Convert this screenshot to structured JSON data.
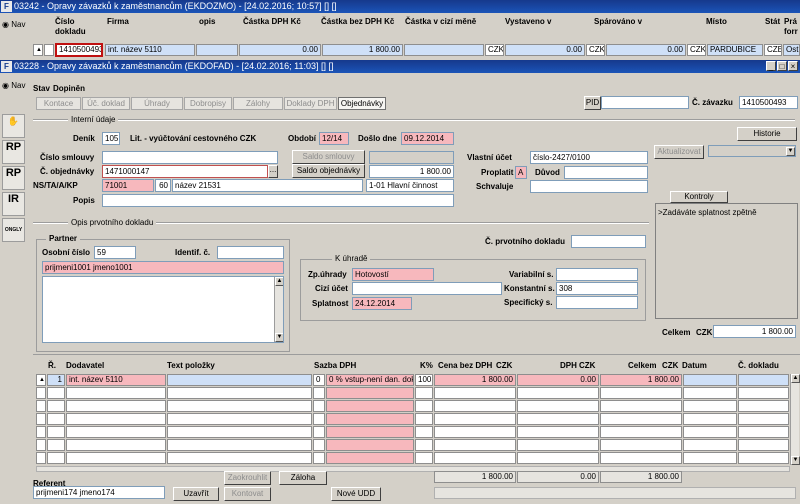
{
  "back_window": {
    "title": "03242 - Opravy závazků k zaměstnancům (EKDOZMO) - [24.02.2016; 10:57] [] []",
    "nav_label": "Nav",
    "columns": [
      "Číslo dokladu",
      "Firma",
      "opis",
      "Částka DPH Kč",
      "Částka bez DPH Kč",
      "Částka v cizí měně",
      "Vystaveno v",
      "Spárováno v",
      "Místo",
      "Stát",
      "Prá forr"
    ],
    "row": {
      "cislo": "1410500493",
      "firma": "int. název 5110",
      "castka_dph": "0.00",
      "castka_bez_dph": "1 800.00",
      "mena1": "CZK",
      "vystaveno": "0.00",
      "mena2": "CZK",
      "sparovano": "0.00",
      "mena3": "CZK",
      "misto": "PARDUBICE",
      "stat": "CZE",
      "pra": "Ost"
    }
  },
  "window": {
    "title": "03228 - Opravy závazků k zaměstnancům (EKDOFAD) - [24.02.2016; 11:03] [] []",
    "nav_label": "Nav",
    "stav_label": "Stav",
    "stav_value": "Dopiněn",
    "tabs": [
      "Kontace",
      "Úč. doklad",
      "Úhrady",
      "Dobropisy",
      "Zálohy",
      "Doklady DPH",
      "Objednávky"
    ],
    "pid_label": "PID",
    "pid_value": "",
    "c_zavazku_label": "Č. závazku",
    "c_zavazku_value": "1410500493",
    "interni_udaje": "Interní údaje",
    "historie": "Historie",
    "denik_label": "Deník",
    "denik_value": "105",
    "denik_text": "Lit. - vyúčtování cestovného CZK",
    "obdobi_label": "Období",
    "obdobi_value": "12/14",
    "doslo_label": "Došlo dne",
    "doslo_value": "09.12.2014",
    "cislo_smlouvy_label": "Číslo smlouvy",
    "cislo_smlouvy_value": "",
    "saldo_smlouvy": "Saldo smlouvy",
    "saldo_smlouvy_value": "",
    "c_objednavky_label": "Č. objednávky",
    "c_objednavky_value": "1471000147",
    "saldo_objednavky": "Saldo objednávky",
    "saldo_objednavky_value": "1 800.00",
    "ns_label": "NS/TA/A/KP",
    "ns_value": "71001",
    "ta_value": "60",
    "a_value": "název 21531",
    "kp_value": "1-01 Hlavní činnost",
    "popis_label": "Popis",
    "popis_value": "",
    "vlastni_ucet_label": "Vlastní účet",
    "vlastni_ucet_value": "číslo-2427/0100",
    "proplatit_label": "Proplatit",
    "proplatit_value": "A",
    "duvod_label": "Důvod",
    "duvod_value": "",
    "schvaluje_label": "Schvaluje",
    "schvaluje_value": "",
    "aktualizovat": "Aktualizovat",
    "kontroly": "Kontroly",
    "kontroly_text": ">Zadáváte splatnost zpětně",
    "opis_group": "Opis prvotního dokladu",
    "partner_group": "Partner",
    "osobni_cislo_label": "Osobní číslo",
    "osobni_cislo_value": "59",
    "identif_label": "Identif. č.",
    "identif_value": "",
    "partner_name": "prijmeni1001 jmeno1001",
    "c_prvotniho_label": "Č. prvotního dokladu",
    "c_prvotniho_value": "",
    "k_uhrade_group": "K úhradě",
    "zp_uhrady_label": "Zp.úhrady",
    "zp_uhrady_value": "Hotovostí",
    "cizi_ucet_label": "Cizí účet",
    "cizi_ucet_value": "",
    "splatnost_label": "Splatnost",
    "splatnost_value": "24.12.2014",
    "variabilni_label": "Variabilní s.",
    "variabilni_value": "",
    "konstantni_label": "Konstantní s.",
    "konstantni_value": "308",
    "specificky_label": "Specifický s.",
    "specificky_value": "",
    "celkem_label": "Celkem",
    "celkem_currency": "CZK",
    "celkem_value": "1 800.00",
    "grid": {
      "headers": {
        "r": "Ř.",
        "dodavatel": "Dodavatel",
        "text": "Text položky",
        "sazba": "Sazba DPH",
        "k": "K%",
        "cena": "Cena bez DPH",
        "cena_cur": "CZK",
        "dph": "DPH",
        "dph_cur": "CZK",
        "celkem": "Celkem",
        "celkem_cur": "CZK",
        "datum": "Datum",
        "c_dokladu": "Č. dokladu"
      },
      "row": {
        "r": "1",
        "dodavatel": "int. název 5110",
        "text": "",
        "sazba_code": "0",
        "sazba": "0 % vstup-není dan. dokl",
        "k": "100",
        "cena": "1 800.00",
        "dph": "0.00",
        "celkem": "1 800.00",
        "datum": "",
        "c_dokladu": ""
      },
      "totals": {
        "cena": "1 800.00",
        "dph": "0.00",
        "celkem": "1 800.00"
      }
    },
    "referent_label": "Referent",
    "referent_value": "prijmeni174 jmeno174",
    "zaokrouhlit": "Zaokrouhlit",
    "zaloha": "Záloha",
    "uzavrit": "Uzavřít",
    "kontovat": "Kontovat",
    "nove_udd": "Nové UDD"
  },
  "sidebar": {
    "icons": [
      "RP",
      "RP",
      "IR",
      "ONGLY"
    ]
  }
}
